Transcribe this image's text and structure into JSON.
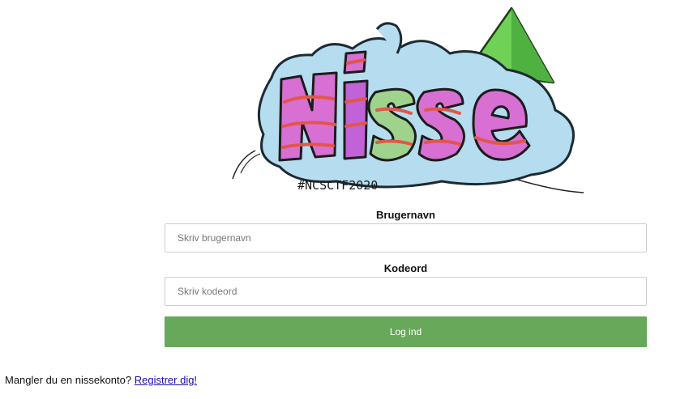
{
  "logo": {
    "icon": "nisse-graffiti-logo",
    "colors": {
      "cloud": "#b6dcef",
      "tree": "#6fd155",
      "letter_pink": "#d86fd3",
      "letter_green": "#9fd38d",
      "stripe": "#e2564a"
    }
  },
  "form": {
    "username_label": "Brugernavn",
    "username_placeholder": "Skriv brugernavn",
    "username_value": "",
    "password_label": "Kodeord",
    "password_placeholder": "Skriv kodeord",
    "password_value": "",
    "login_label": "Log ind",
    "login_color": "#67a85a"
  },
  "footer": {
    "prompt_text": "Mangler du en nissekonto?",
    "register_link": "Registrer dig!"
  }
}
